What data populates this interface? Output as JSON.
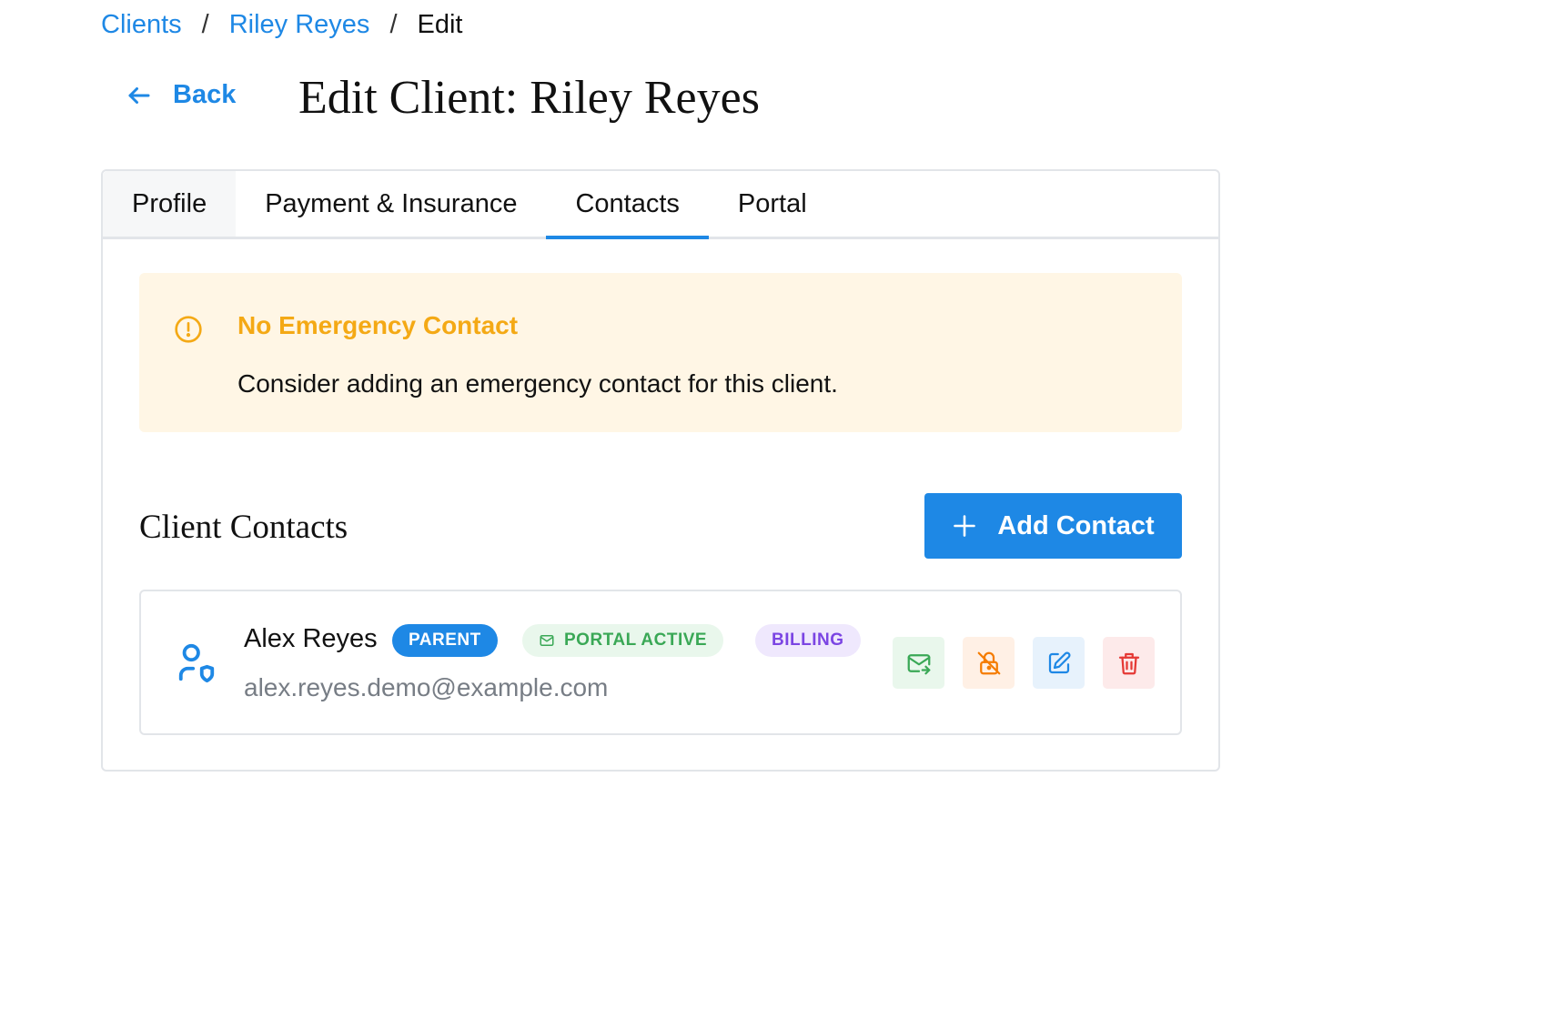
{
  "breadcrumb": {
    "items": [
      "Clients",
      "Riley Reyes"
    ],
    "separator": "/",
    "current": "Edit"
  },
  "header": {
    "back_label": "Back",
    "title": "Edit Client: Riley Reyes"
  },
  "tabs": [
    {
      "label": "Profile"
    },
    {
      "label": "Payment & Insurance"
    },
    {
      "label": "Contacts",
      "active": true
    },
    {
      "label": "Portal"
    }
  ],
  "alert": {
    "icon": "alert-circle-icon",
    "title": "No Emergency Contact",
    "message": "Consider adding an emergency contact for this client."
  },
  "contacts_section": {
    "title": "Client Contacts",
    "add_button_label": "Add Contact",
    "contacts": [
      {
        "name": "Alex Reyes",
        "email": "alex.reyes.demo@example.com",
        "badges": {
          "relation": "PARENT",
          "portal": "PORTAL ACTIVE",
          "billing": "BILLING"
        },
        "actions": [
          "resend-invite",
          "revoke-portal-access",
          "edit",
          "delete"
        ]
      }
    ]
  },
  "colors": {
    "accent": "#1e88e5",
    "warning": "#f4a915",
    "warning_bg": "#fff6e5",
    "success": "#3aa856",
    "billing": "#7b45e3",
    "danger": "#e53935",
    "orange": "#f57c00"
  }
}
